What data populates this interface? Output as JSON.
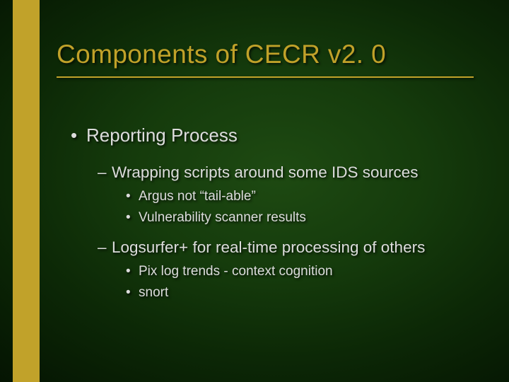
{
  "title": "Components of CECR v2. 0",
  "level1": {
    "bullet": "•",
    "text": "Reporting Process"
  },
  "group1": {
    "dash": "–",
    "text": "Wrapping scripts around some IDS sources",
    "items": [
      {
        "bullet": "•",
        "text": "Argus not “tail-able”"
      },
      {
        "bullet": "•",
        "text": "Vulnerability scanner results"
      }
    ]
  },
  "group2": {
    "dash": "–",
    "text": "Logsurfer+ for real-time processing of others",
    "items": [
      {
        "bullet": "•",
        "text": "Pix log trends - context cognition"
      },
      {
        "bullet": "•",
        "text": "snort"
      }
    ]
  }
}
